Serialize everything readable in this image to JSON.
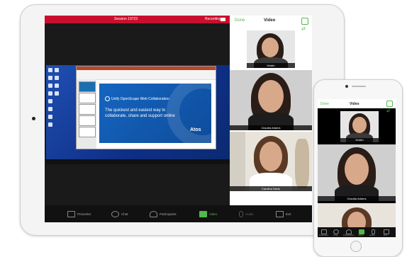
{
  "ipad": {
    "meeting_bar_title": "Session 19723",
    "meeting_bar_right": "Recording",
    "video_panel": {
      "done_label": "Done",
      "title": "Video",
      "tiles": [
        {
          "name": "Kristin"
        },
        {
          "name": "Claudia Adams"
        },
        {
          "name": "Carolina Davis"
        }
      ]
    },
    "slide": {
      "title": "Unify OpenScape Web Collaboration",
      "subtitle": "The quickest and easiest way to collaborate, share and support online",
      "brand": "Atos"
    },
    "toolbar": [
      {
        "icon": "screen-share-icon",
        "label": "Presenter"
      },
      {
        "icon": "chat-icon",
        "label": "Chat"
      },
      {
        "icon": "participants-icon",
        "label": "Participants"
      },
      {
        "icon": "video-camera-icon",
        "label": "Video"
      },
      {
        "icon": "microphone-icon",
        "label": "Audio"
      },
      {
        "icon": "exit-icon",
        "label": "Exit"
      }
    ]
  },
  "iphone": {
    "done_label": "Done",
    "title": "Video",
    "tiles": [
      {
        "name": "Kristin"
      },
      {
        "name": "Claudia Adams"
      },
      {
        "name": ""
      }
    ],
    "toolbar": [
      {
        "icon": "screen-share-icon",
        "label": "Presenter"
      },
      {
        "icon": "chat-icon",
        "label": "Chat"
      },
      {
        "icon": "participants-icon",
        "label": "Participants"
      },
      {
        "icon": "video-camera-icon",
        "label": "Video"
      },
      {
        "icon": "microphone-icon",
        "label": "Audio"
      },
      {
        "icon": "exit-icon",
        "label": "Exit"
      }
    ]
  },
  "colors": {
    "accent_green": "#53b84a",
    "bar_red": "#c8102e",
    "desktop_blue": "#1f4fb4"
  }
}
